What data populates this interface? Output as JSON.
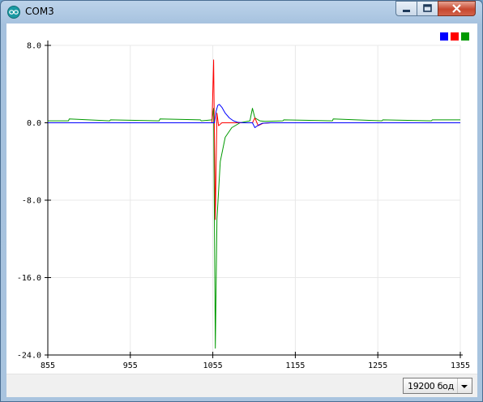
{
  "window": {
    "title": "COM3",
    "icon": "arduino-icon",
    "controls": [
      "minimize-icon",
      "maximize-icon",
      "close-icon"
    ]
  },
  "legend": {
    "series_colors": [
      "#0000ff",
      "#ff0000",
      "#009900"
    ]
  },
  "chart_data": {
    "type": "line",
    "xlim": [
      855,
      1355
    ],
    "ylim": [
      -24.0,
      8.0
    ],
    "x_ticks": [
      "855",
      "955",
      "1055",
      "1155",
      "1255",
      "1355"
    ],
    "y_ticks": [
      "8.0",
      "0.0",
      "-8.0",
      "-16.0",
      "-24.0"
    ],
    "grid": true,
    "legend_position": "top-right",
    "series": [
      {
        "color": "#0000ff",
        "x": [
          855,
          1055,
          1057,
          1059,
          1061,
          1063,
          1066,
          1070,
          1075,
          1080,
          1085,
          1092,
          1100,
          1103,
          1106,
          1110,
          1115,
          1125,
          1355
        ],
        "y": [
          0.0,
          0.0,
          0.0,
          1.2,
          1.8,
          1.9,
          1.6,
          1.0,
          0.5,
          0.2,
          0.05,
          0.0,
          0.0,
          0.0,
          -0.5,
          -0.25,
          -0.05,
          0.0,
          0.0
        ]
      },
      {
        "color": "#ff0000",
        "x": [
          855,
          1054,
          1056,
          1058,
          1060,
          1062,
          1066,
          1070,
          1080,
          1100,
          1103,
          1106,
          1110,
          1116,
          1125,
          1355
        ],
        "y": [
          0.0,
          0.0,
          6.5,
          -10.0,
          1.0,
          -0.3,
          0.0,
          0.0,
          0.0,
          0.0,
          0.0,
          0.5,
          -0.3,
          -0.05,
          0.0,
          0.0
        ],
        "noise": false
      },
      {
        "color": "#009900",
        "x": [
          855,
          880,
          881,
          930,
          931,
          990,
          991,
          1040,
          1041,
          1054,
          1056,
          1058,
          1060,
          1064,
          1070,
          1078,
          1088,
          1100,
          1103,
          1106,
          1112,
          1118,
          1140,
          1141,
          1200,
          1201,
          1260,
          1261,
          1320,
          1321,
          1355
        ],
        "y": [
          0.2,
          0.2,
          0.4,
          0.2,
          0.3,
          0.2,
          0.4,
          0.3,
          0.2,
          0.3,
          1.5,
          -23.3,
          -10.0,
          -4.0,
          -1.5,
          -0.5,
          0.0,
          0.2,
          1.5,
          0.5,
          0.2,
          0.15,
          0.2,
          0.3,
          0.2,
          0.4,
          0.2,
          0.3,
          0.2,
          0.3,
          0.3
        ]
      }
    ]
  },
  "statusbar": {
    "baud_value": "19200 бод"
  }
}
